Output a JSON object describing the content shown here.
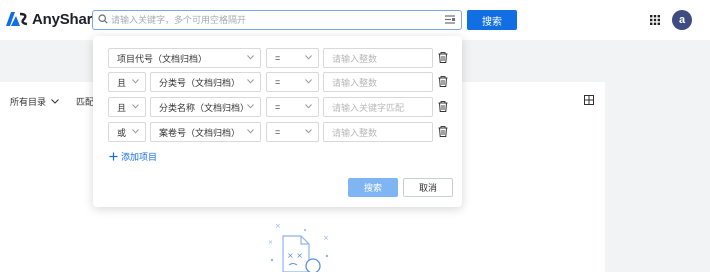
{
  "header": {
    "app_name": "AnyShare",
    "search_placeholder": "请输入关键字，多个可用空格隔开",
    "search_button": "搜索",
    "avatar_letter": "a"
  },
  "toolbar": {
    "directory_select": "所有目录",
    "match_label": "匹配"
  },
  "advanced_search": {
    "rows": [
      {
        "logic": "",
        "field": "项目代号（文档归档）",
        "operator": "=",
        "value_placeholder": "请输入整数"
      },
      {
        "logic": "且",
        "field": "分类号（文档归档）",
        "operator": "=",
        "value_placeholder": "请输入整数"
      },
      {
        "logic": "且",
        "field": "分类名称（文档归档）",
        "operator": "=",
        "value_placeholder": "请输入关键字匹配"
      },
      {
        "logic": "或",
        "field": "案卷号（文档归档）",
        "operator": "=",
        "value_placeholder": "请输入整数"
      }
    ],
    "add_condition": "添加项目",
    "search_button": "搜索",
    "cancel_button": "取消"
  },
  "colors": {
    "primary": "#126ee3",
    "primary_disabled": "#7fb5f3",
    "avatar_bg": "#3e4c81"
  }
}
